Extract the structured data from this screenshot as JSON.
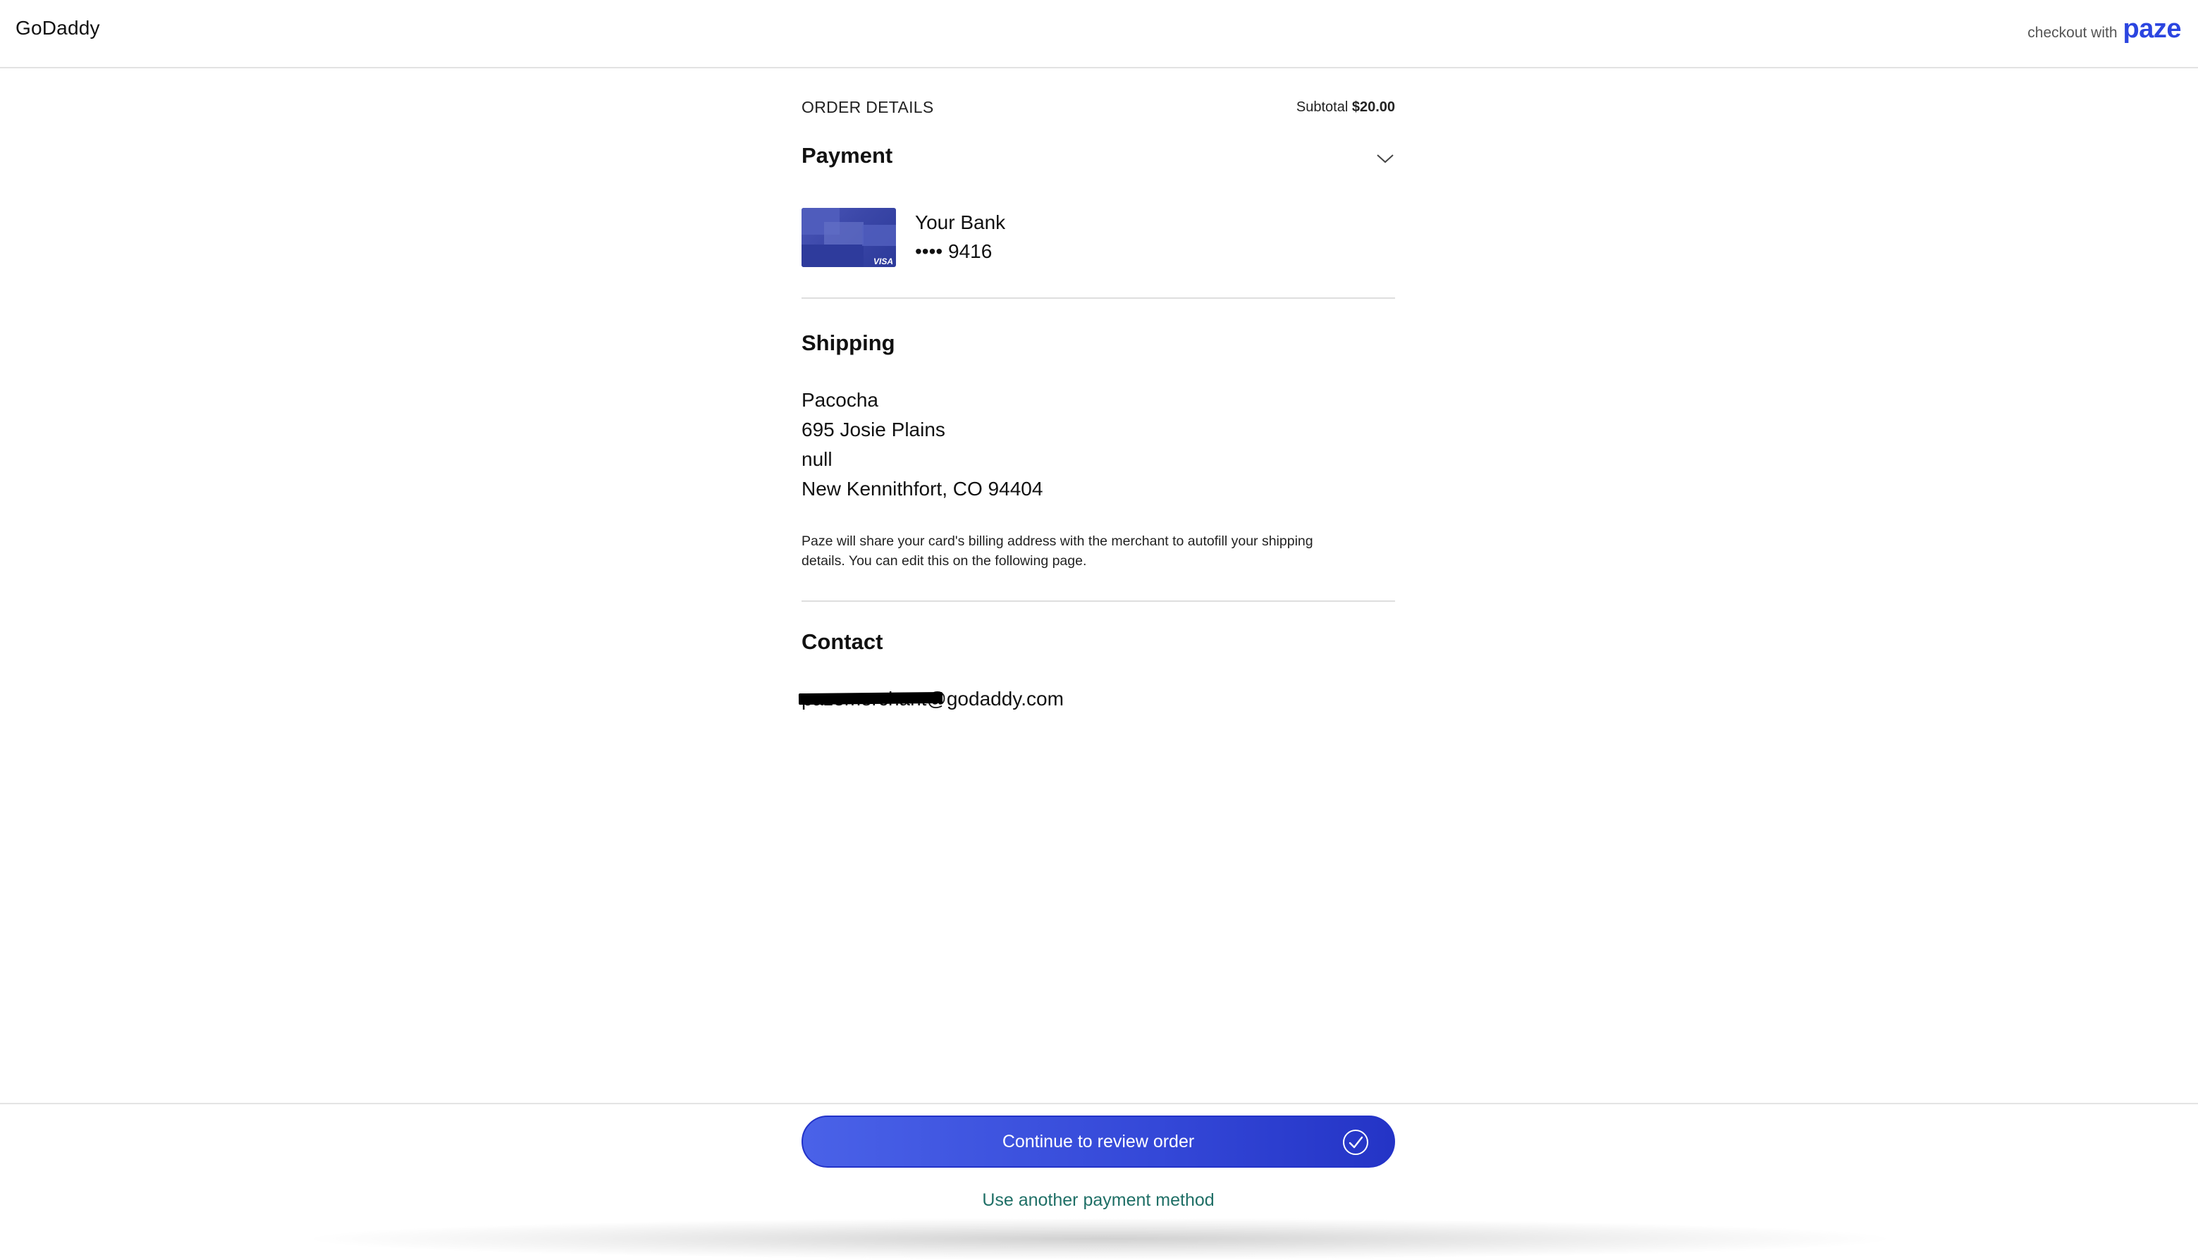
{
  "header": {
    "merchant": "GoDaddy",
    "checkout_with": "checkout with",
    "brand": "paze",
    "brand_color": "#2b45e0"
  },
  "order": {
    "title": "ORDER DETAILS",
    "subtotal_label": "Subtotal",
    "subtotal_value": "$20.00"
  },
  "payment": {
    "title": "Payment",
    "toggle_icon": "chevron-down-icon",
    "card_network": "VISA",
    "bank_name": "Your Bank",
    "card_number": "•••• 9416"
  },
  "shipping": {
    "title": "Shipping",
    "address_lines": [
      "Pacocha",
      "695 Josie Plains",
      "null",
      "New Kennithfort, CO 94404"
    ],
    "note_line1": "Paze will share your card's billing address with the merchant to autofill your shipping",
    "note_line2": "details. You can edit this on the following page."
  },
  "contact": {
    "title": "Contact",
    "email_visible": "pazemerchant@godaddy.com"
  },
  "actions": {
    "continue_label": "Continue to review order",
    "continue_icon": "check-circle-icon",
    "accent_color": "#3448d8",
    "alt_payment_label": "Use another payment method"
  }
}
